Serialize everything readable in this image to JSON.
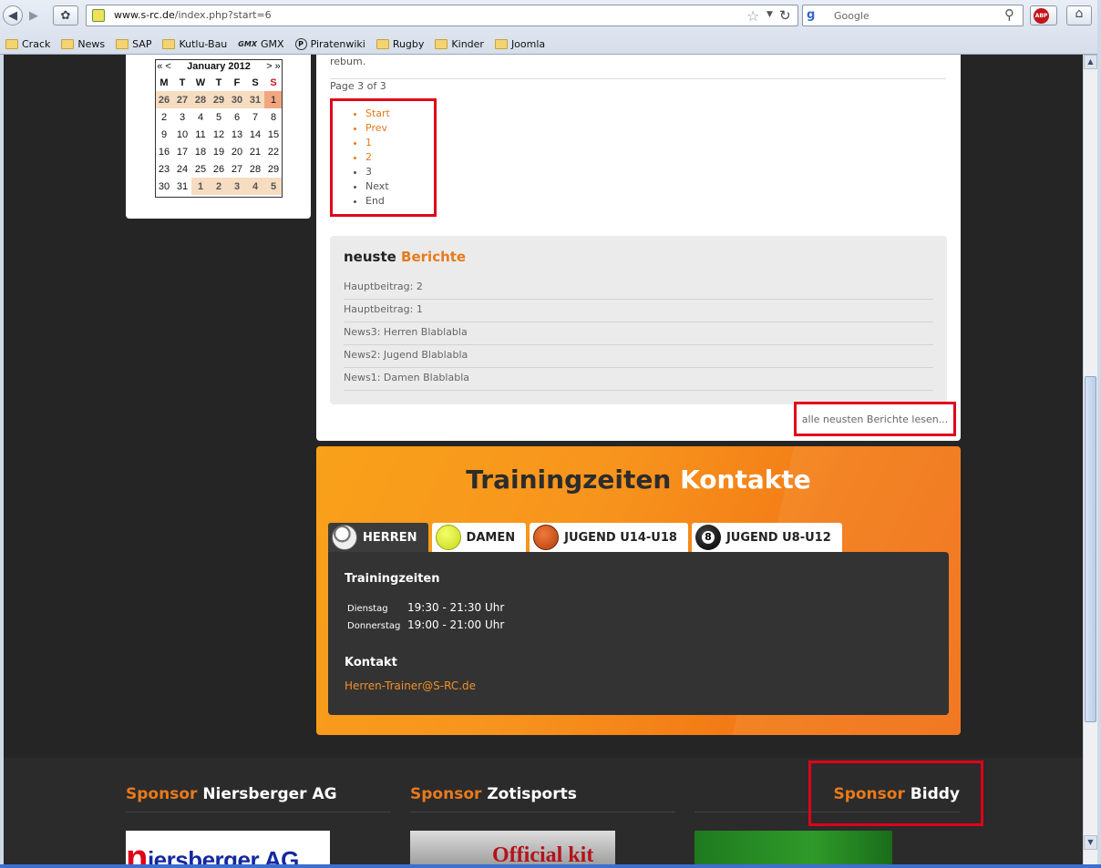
{
  "browser": {
    "url_host": "www.s-rc.de",
    "url_path": "/index.php?start=6",
    "search_placeholder": "Google",
    "bookmarks": [
      "Crack",
      "News",
      "SAP",
      "Kutlu-Bau",
      "GMX",
      "Piratenwiki",
      "Rugby",
      "Kinder",
      "Joomla"
    ],
    "abp_label": "ABP"
  },
  "calendar": {
    "prev_nav": "« <",
    "month": "January 2012",
    "next_nav": "> »",
    "weekdays": [
      "M",
      "T",
      "W",
      "T",
      "F",
      "S",
      "S"
    ],
    "weeks": [
      [
        "26",
        "27",
        "28",
        "29",
        "30",
        "31",
        "1"
      ],
      [
        "2",
        "3",
        "4",
        "5",
        "6",
        "7",
        "8"
      ],
      [
        "9",
        "10",
        "11",
        "12",
        "13",
        "14",
        "15"
      ],
      [
        "16",
        "17",
        "18",
        "19",
        "20",
        "21",
        "22"
      ],
      [
        "23",
        "24",
        "25",
        "26",
        "27",
        "28",
        "29"
      ],
      [
        "30",
        "31",
        "1",
        "2",
        "3",
        "4",
        "5"
      ]
    ]
  },
  "content": {
    "rebum": "rebum.",
    "page_of": "Page 3 of 3",
    "pagination": [
      "Start",
      "Prev",
      "1",
      "2",
      "3",
      "Next",
      "End"
    ],
    "news_title_dark": "neuste",
    "news_title_accent": "Berichte",
    "news_items": [
      "Hauptbeitrag: 2",
      "Hauptbeitrag: 1",
      "News3: Herren Blablabla",
      "News2: Jugend Blablabla",
      "News1: Damen Blablabla"
    ],
    "read_more": "alle neusten Berichte lesen..."
  },
  "training": {
    "title_dark": "Trainingzeiten",
    "title_light": "Kontakte",
    "tabs": [
      "HERREN",
      "DAMEN",
      "JUGEND U14-U18",
      "JUGEND U8-U12"
    ],
    "panel_heading": "Trainingzeiten",
    "rows": [
      {
        "day": "Dienstag",
        "time": "19:30 - 21:30 Uhr"
      },
      {
        "day": "Donnerstag",
        "time": "19:00 - 21:00 Uhr"
      }
    ],
    "contact_heading": "Kontakt",
    "contact_email": "Herren-Trainer@S-RC.de"
  },
  "footer": {
    "sponsors": [
      {
        "prefix": "Sponsor",
        "name": "Niersberger AG"
      },
      {
        "prefix": "Sponsor",
        "name": "Zotisports"
      },
      {
        "prefix": "Sponsor",
        "name": "Biddy"
      }
    ],
    "logo1_n": "n",
    "logo1_rest": "iersberger AG",
    "logo2_text": "Official kit"
  }
}
